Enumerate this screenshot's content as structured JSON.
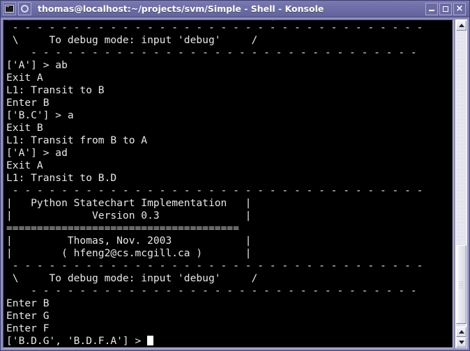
{
  "window": {
    "title": "thomas@localhost:~/projects/svm/Simple - Shell - Konsole",
    "icons": {
      "app_icon": "terminal-monitor-icon",
      "menu_icon": "circle-icon"
    },
    "buttons": {
      "minimize": "_",
      "maximize": "□",
      "close": "×"
    }
  },
  "terminal": {
    "lines": [
      "|        ( hfeng2@cs.mcgill.ca )           |",
      " - - - - - - - - - - - - - - - - - - - - - - - - - - - - - - - - - -",
      " \\     To debug mode: input 'debug'     /",
      "    - - - - - - - - - - - - - - - - - - - - - - - - - - - - - - - -",
      "['A'] > ab",
      "Exit A",
      "L1: Transit to B",
      "Enter B",
      "['B.C'] > a",
      "Exit B",
      "L1: Transit from B to A",
      "['A'] > ad",
      "Exit A",
      "L1: Transit to B.D",
      " - - - - - - - - - - - - - - - - - - - - - - - - - - - - - - - - - -",
      "|   Python Statechart Implementation   |",
      "|             Version 0.3              |",
      "======================================",
      "|         Thomas, Nov. 2003            |",
      "|        ( hfeng2@cs.mcgill.ca )       |",
      " - - - - - - - - - - - - - - - - - - - - - - - - - - - - - - - - - -",
      " \\     To debug mode: input 'debug'     /",
      "    - - - - - - - - - - - - - - - - - - - - - - - - - - - - - - - -",
      "Enter B",
      "Enter G",
      "Enter F"
    ],
    "prompt": "['B.D.G', 'B.D.F.A'] > ",
    "cursor": "block-cursor",
    "foreground_color": "#e8e8e8",
    "background_color": "#000000"
  },
  "scrollbar": {
    "top_arrow": "scroll-up-arrow",
    "bottom_arrows": [
      "scroll-up-arrow",
      "scroll-down-arrow"
    ],
    "thumb": "scroll-thumb"
  }
}
